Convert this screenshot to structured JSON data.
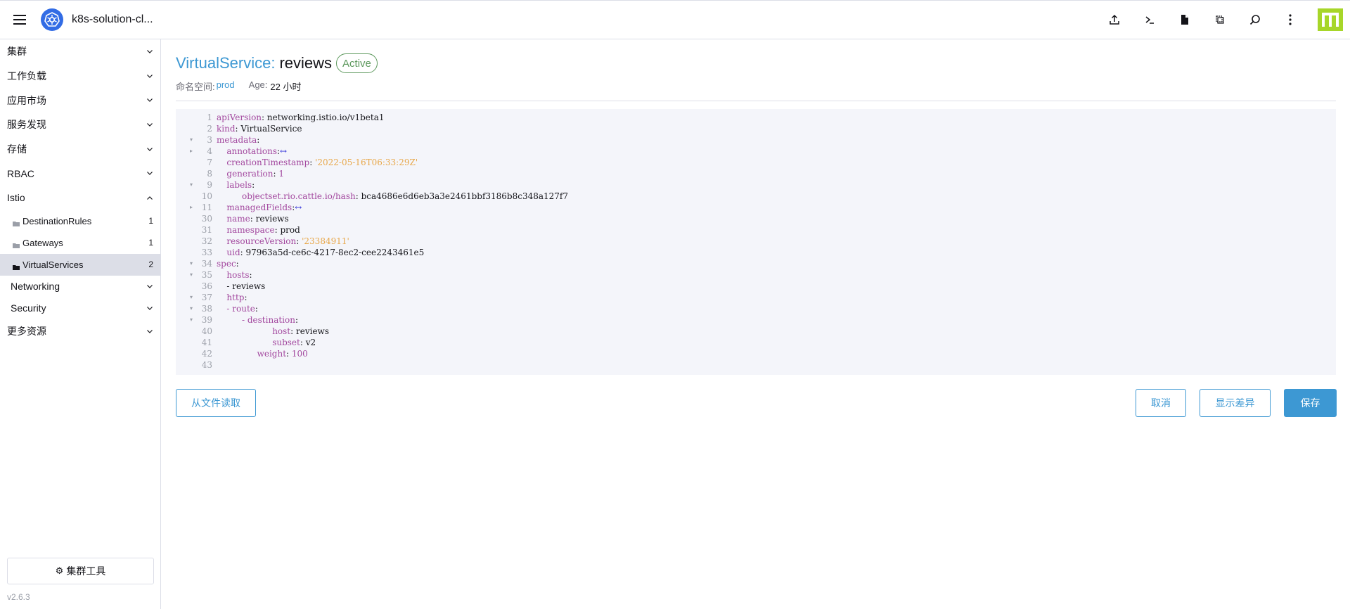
{
  "header": {
    "cluster_name": "k8s-solution-cl...",
    "icons": [
      "upload-icon",
      "terminal-icon",
      "file-icon",
      "copy-icon",
      "search-icon",
      "more-vertical-icon"
    ]
  },
  "sidebar": {
    "groups": [
      {
        "label": "集群",
        "expanded": false
      },
      {
        "label": "工作负载",
        "expanded": false
      },
      {
        "label": "应用市场",
        "expanded": false
      },
      {
        "label": "服务发现",
        "expanded": false
      },
      {
        "label": "存储",
        "expanded": false
      },
      {
        "label": "RBAC",
        "expanded": false
      },
      {
        "label": "Istio",
        "expanded": true
      }
    ],
    "istio_items": [
      {
        "label": "DestinationRules",
        "count": "1"
      },
      {
        "label": "Gateways",
        "count": "1"
      },
      {
        "label": "VirtualServices",
        "count": "2"
      }
    ],
    "sub_groups": [
      {
        "label": "Networking"
      },
      {
        "label": "Security"
      }
    ],
    "more_resources": "更多资源",
    "cluster_tools": "集群工具",
    "version": "v2.6.3"
  },
  "page": {
    "kind": "VirtualService:",
    "name": "reviews",
    "status": "Active",
    "namespace_label": "命名空间:",
    "namespace": "prod",
    "age_label": "Age:",
    "age": "22 小时"
  },
  "yaml_lines": [
    {
      "n": "1",
      "fold": "",
      "indent": 0,
      "key": "apiVersion",
      "sep": ": ",
      "val": "networking.istio.io/v1beta1",
      "vtype": "plain"
    },
    {
      "n": "2",
      "fold": "",
      "indent": 0,
      "key": "kind",
      "sep": ": ",
      "val": "VirtualService",
      "vtype": "plain"
    },
    {
      "n": "3",
      "fold": "▾",
      "indent": 0,
      "key": "metadata",
      "sep": ":",
      "val": "",
      "vtype": "plain"
    },
    {
      "n": "4",
      "fold": "▸",
      "indent": 2,
      "key": "annotations",
      "sep": ":",
      "val": "↔",
      "vtype": "ellip"
    },
    {
      "n": "7",
      "fold": "",
      "indent": 2,
      "key": "creationTimestamp",
      "sep": ": ",
      "val": "'2022-05-16T06:33:29Z'",
      "vtype": "str"
    },
    {
      "n": "8",
      "fold": "",
      "indent": 2,
      "key": "generation",
      "sep": ": ",
      "val": "1",
      "vtype": "num"
    },
    {
      "n": "9",
      "fold": "▾",
      "indent": 2,
      "key": "labels",
      "sep": ":",
      "val": "",
      "vtype": "plain"
    },
    {
      "n": "10",
      "fold": "",
      "indent": 5,
      "key": "objectset.rio.cattle.io/hash",
      "sep": ": ",
      "val": "bca4686e6d6eb3a3e2461bbf3186b8c348a127f7",
      "vtype": "plain"
    },
    {
      "n": "11",
      "fold": "▸",
      "indent": 2,
      "key": "managedFields",
      "sep": ":",
      "val": "↔",
      "vtype": "ellip"
    },
    {
      "n": "30",
      "fold": "",
      "indent": 2,
      "key": "name",
      "sep": ": ",
      "val": "reviews",
      "vtype": "plain"
    },
    {
      "n": "31",
      "fold": "",
      "indent": 2,
      "key": "namespace",
      "sep": ": ",
      "val": "prod",
      "vtype": "plain"
    },
    {
      "n": "32",
      "fold": "",
      "indent": 2,
      "key": "resourceVersion",
      "sep": ": ",
      "val": "'23384911'",
      "vtype": "str"
    },
    {
      "n": "33",
      "fold": "",
      "indent": 2,
      "key": "uid",
      "sep": ": ",
      "val": "97963a5d-ce6c-4217-8ec2-cee2243461e5",
      "vtype": "plain"
    },
    {
      "n": "34",
      "fold": "▾",
      "indent": 0,
      "key": "spec",
      "sep": ":",
      "val": "",
      "vtype": "plain"
    },
    {
      "n": "35",
      "fold": "▾",
      "indent": 2,
      "key": "hosts",
      "sep": ":",
      "val": "",
      "vtype": "plain"
    },
    {
      "n": "36",
      "fold": "",
      "indent": 2,
      "key": "",
      "sep": "- ",
      "val": "reviews",
      "vtype": "plain"
    },
    {
      "n": "37",
      "fold": "▾",
      "indent": 2,
      "key": "http",
      "sep": ":",
      "val": "",
      "vtype": "plain"
    },
    {
      "n": "38",
      "fold": "▾",
      "indent": 2,
      "key": "- route",
      "sep": ":",
      "val": "",
      "vtype": "plain"
    },
    {
      "n": "39",
      "fold": "▾",
      "indent": 5,
      "key": "- destination",
      "sep": ":",
      "val": "",
      "vtype": "plain"
    },
    {
      "n": "40",
      "fold": "",
      "indent": 11,
      "key": "host",
      "sep": ": ",
      "val": "reviews",
      "vtype": "plain"
    },
    {
      "n": "41",
      "fold": "",
      "indent": 11,
      "key": "subset",
      "sep": ": ",
      "val": "v2",
      "vtype": "plain"
    },
    {
      "n": "42",
      "fold": "",
      "indent": 8,
      "key": "weight",
      "sep": ": ",
      "val": "100",
      "vtype": "num"
    },
    {
      "n": "43",
      "fold": "",
      "indent": 0,
      "key": "",
      "sep": "",
      "val": "",
      "vtype": "plain"
    }
  ],
  "actions": {
    "read_from_file": "从文件读取",
    "cancel": "取消",
    "show_diff": "显示差异",
    "save": "保存"
  }
}
